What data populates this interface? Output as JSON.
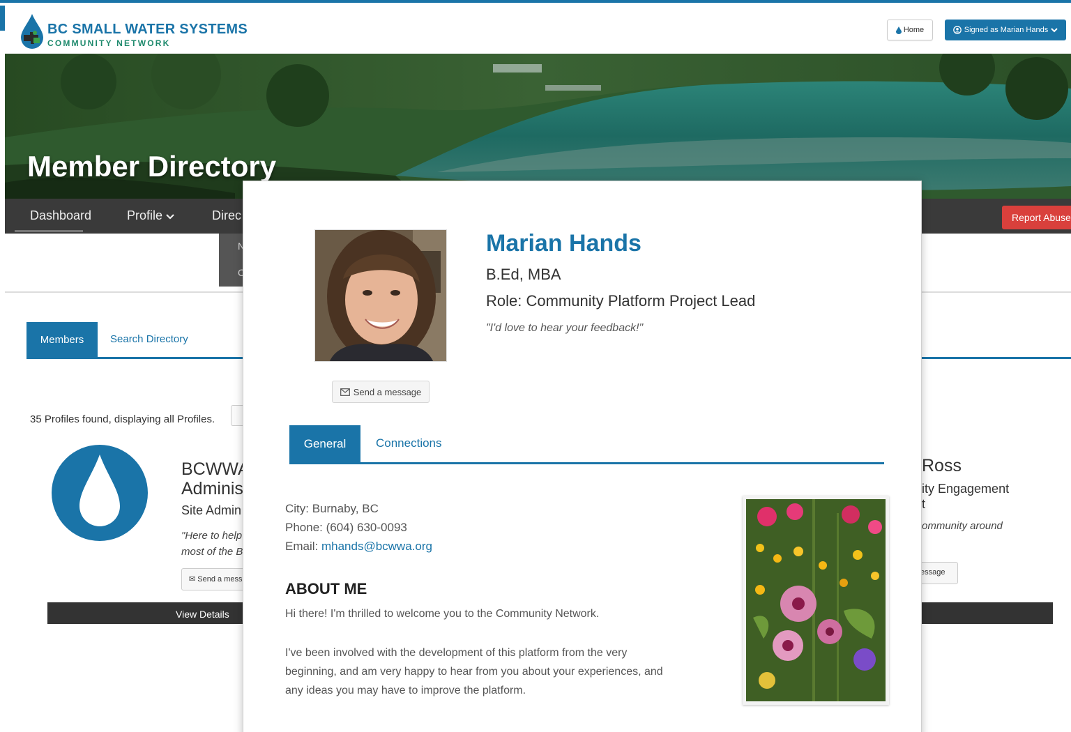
{
  "brand": {
    "name_line1": "BC SMALL WATER SYSTEMS",
    "name_line2": "COMMUNITY NETWORK"
  },
  "header": {
    "home_label": "Home",
    "signed_label": "Signed as Marian Hands"
  },
  "hero": {
    "title": "Member Directory"
  },
  "nav": {
    "items": [
      "Dashboard",
      "Profile",
      "Direc"
    ],
    "report_label": "Report Abuse",
    "dropdown_fragments": [
      "N",
      "C"
    ]
  },
  "directory": {
    "tabs": [
      "Members",
      "Search Directory"
    ],
    "profiles_found": "35 Profiles found, displaying all Profiles.",
    "left_card": {
      "name_line1": "BCWWA",
      "name_line2": "Adminis",
      "role": "Site Admin",
      "quote_line1": "\"Here to help",
      "quote_line2": "most of the B",
      "send_label": "Send a mess",
      "view_details": "View Details"
    },
    "right_card": {
      "name": "Ross",
      "role_line1": "ity Engagement",
      "role_line2": "t",
      "quote": "ommunity around",
      "send_label": "essage"
    }
  },
  "profile": {
    "name": "Marian Hands",
    "credentials": "B.Ed, MBA",
    "role": "Role: Community Platform Project Lead",
    "quote": "\"I'd love to hear your feedback!\"",
    "send_label": "Send a message",
    "tabs": [
      "General",
      "Connections"
    ],
    "city": "City: Burnaby, BC",
    "phone": "Phone: (604) 630-0093",
    "email_label": "Email: ",
    "email": "mhands@bcwwa.org",
    "about_heading": "ABOUT ME",
    "about_p1": "Hi there! I'm thrilled to welcome you to the Community Network.",
    "about_p2": "I've been involved with the development of this platform from the very beginning, and am very happy to hear from you about your experiences, and any ideas you may have to improve the platform."
  },
  "colors": {
    "brand_blue": "#1a74a8",
    "brand_green": "#1f8a6d",
    "nav_dark": "#3a3a3a",
    "report_red": "#d9403c"
  }
}
